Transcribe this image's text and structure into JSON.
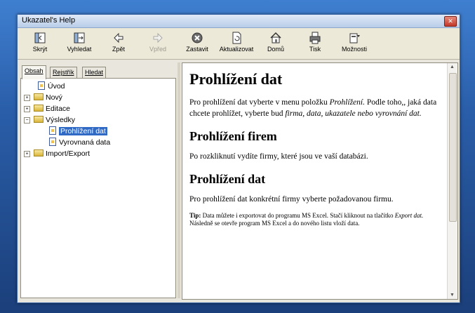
{
  "window": {
    "title": "Ukazatel's Help"
  },
  "toolbar": [
    {
      "label": "Skrýt",
      "icon": "hide-icon",
      "enabled": true
    },
    {
      "label": "Vyhledat",
      "icon": "locate-icon",
      "enabled": true
    },
    {
      "label": "Zpět",
      "icon": "back-arrow-icon",
      "enabled": true
    },
    {
      "label": "Vpřed",
      "icon": "forward-arrow-icon",
      "enabled": false
    },
    {
      "label": "Zastavit",
      "icon": "stop-icon",
      "enabled": true
    },
    {
      "label": "Aktualizovat",
      "icon": "refresh-icon",
      "enabled": true
    },
    {
      "label": "Domů",
      "icon": "home-icon",
      "enabled": true
    },
    {
      "label": "Tisk",
      "icon": "print-icon",
      "enabled": true
    },
    {
      "label": "Možnosti",
      "icon": "options-icon",
      "enabled": true
    }
  ],
  "tabs": [
    "Obsah",
    "Rejstřík",
    "Hledat"
  ],
  "tree": {
    "items": [
      "Úvod",
      "Nový",
      "Editace",
      "Výsledky",
      "Prohlížení dat",
      "Vyrovnaná data",
      "Import/Export"
    ]
  },
  "content": {
    "h1": "Prohlížení dat",
    "p1_a": "Pro prohlížení dat vyberte v menu položku ",
    "p1_em1": "Prohlížení.",
    "p1_b": " Podle toho,, jaká data chcete prohlížet, vyberte bud ",
    "p1_em2": "firma, data, ukazatele nebo vyrovnání dat.",
    "h2_firms": "Prohlížení firem",
    "p2": "Po rozkliknutí vydíte firmy, které jsou ve vaší databázi.",
    "h2_data": "Prohlížení dat",
    "p3": "Pro prohlížení dat konkrétní firmy vyberte požadovanou firmu.",
    "tip_label": "Tip:",
    "tip_a": " Data můžete i exportovat do programu MS Excel. Stačí kliknout na tlačítko ",
    "tip_em": "Export dat.",
    "tip_b": " Následně se otevře program MS Excel a do nového listu vloží data."
  },
  "colors": {
    "selection": "#316ac5",
    "desktop": "#2a5ea9",
    "titlebar": "#b9cde8"
  }
}
